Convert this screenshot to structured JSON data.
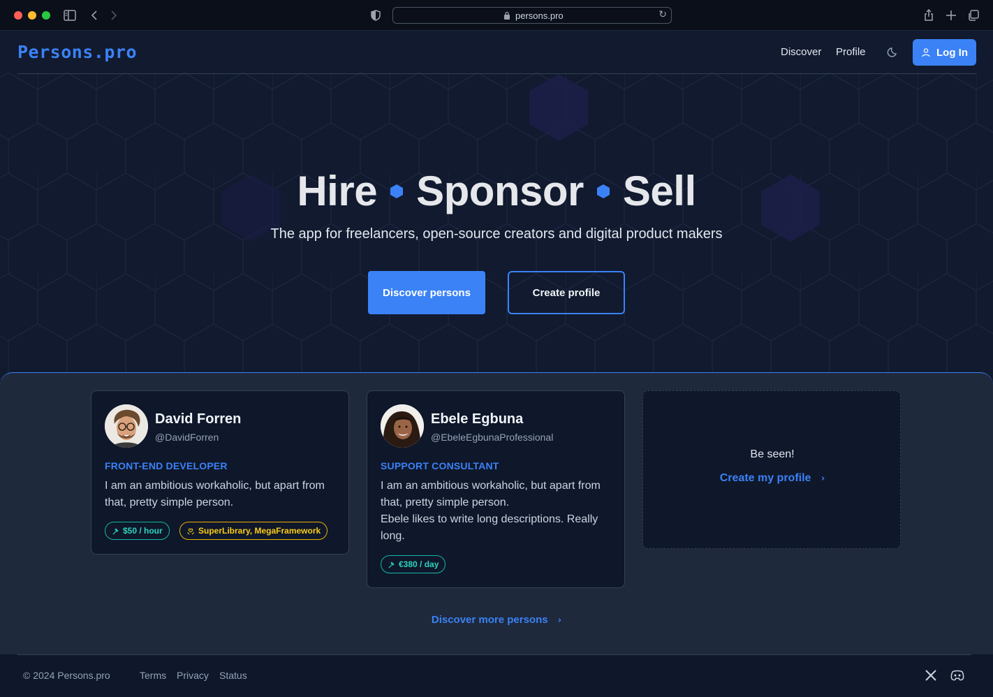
{
  "browser": {
    "url": "persons.pro",
    "icons": [
      "sidebar-icon",
      "back-icon",
      "forward-icon",
      "shield-icon",
      "lock-icon",
      "reload-icon",
      "share-icon",
      "new-tab-icon",
      "tabs-icon"
    ]
  },
  "nav": {
    "logo": "Persons.pro",
    "links": [
      "Discover",
      "Profile"
    ],
    "login_label": "Log In"
  },
  "hero": {
    "words": [
      "Hire",
      "Sponsor",
      "Sell"
    ],
    "subtitle": "The app for freelancers, open-source creators and digital product makers",
    "primary_cta": "Discover persons",
    "secondary_cta": "Create profile"
  },
  "cards": [
    {
      "name": "David Forren",
      "handle": "@DavidForren",
      "role": "FRONT-END DEVELOPER",
      "bio": "I am an ambitious workaholic, but apart from that, pretty simple person.",
      "tags": [
        {
          "label": "$50 / hour",
          "icon": "hammer-icon"
        },
        {
          "label": "SuperLibrary, MegaFramework",
          "icon": "heart-hands-icon"
        }
      ]
    },
    {
      "name": "Ebele Egbuna",
      "handle": "@EbeleEgbunaProfessional",
      "role": "SUPPORT CONSULTANT",
      "bio1": "I am an ambitious workaholic, but apart from that, pretty simple person.",
      "bio2": "Ebele likes to write long descriptions. Really long.",
      "tags": [
        {
          "label": "€380 / day",
          "icon": "hammer-icon"
        }
      ]
    }
  ],
  "cta_card": {
    "title": "Be seen!",
    "link": "Create my profile"
  },
  "more_link": "Discover more persons",
  "footer": {
    "copyright": "© 2024 Persons.pro",
    "links": [
      "Terms",
      "Privacy",
      "Status"
    ],
    "social_icons": [
      "x-icon",
      "discord-icon"
    ]
  },
  "colors": {
    "accent": "#3b82f6",
    "background": "#111a2e",
    "section": "#1e293b",
    "tag_teal": "#2dd4bf",
    "tag_amber": "#facc15"
  }
}
